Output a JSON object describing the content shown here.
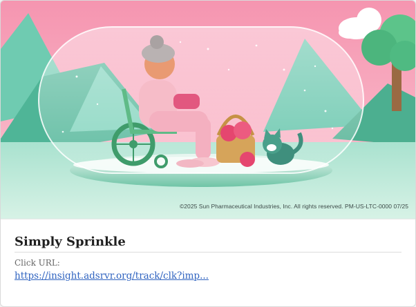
{
  "ad": {
    "image_alt": "Simply Sprinkle illustration",
    "copyright": "©2025 Sun Pharmaceutical Industries, Inc. All rights reserved. PM-US-LTC-0000 07/25"
  },
  "info": {
    "title": "Simply Sprinkle",
    "click_url_label": "Click URL:",
    "click_url": "https://insight.adsrvr.org/track/clk?imp..."
  },
  "colors": {
    "sky_pink": "#f7a9bd",
    "mountain_green": "#5fc3a8",
    "floor_mint": "#bfe8d8",
    "link_blue": "#2f63c0"
  }
}
